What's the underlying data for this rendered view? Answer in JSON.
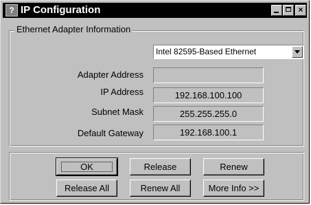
{
  "window": {
    "title": "IP Configuration",
    "icon": "help-icon",
    "icon_glyph": "?",
    "minimize_glyph": "",
    "close_glyph": "×"
  },
  "adapter_group": {
    "legend": "Ethernet  Adapter Information",
    "adapter_select": "Intel 82595-Based Ethernet"
  },
  "fields": {
    "adapter_address": {
      "label": "Adapter Address",
      "value": ""
    },
    "ip_address": {
      "label": "IP Address",
      "value": "192.168.100.100"
    },
    "subnet_mask": {
      "label": "Subnet Mask",
      "value": "255.255.255.0"
    },
    "default_gateway": {
      "label": "Default Gateway",
      "value": "192.168.100.1"
    }
  },
  "buttons": {
    "ok": "OK",
    "release": "Release",
    "renew": "Renew",
    "release_all": "Release All",
    "renew_all": "Renew All",
    "more_info": "More Info >>"
  }
}
